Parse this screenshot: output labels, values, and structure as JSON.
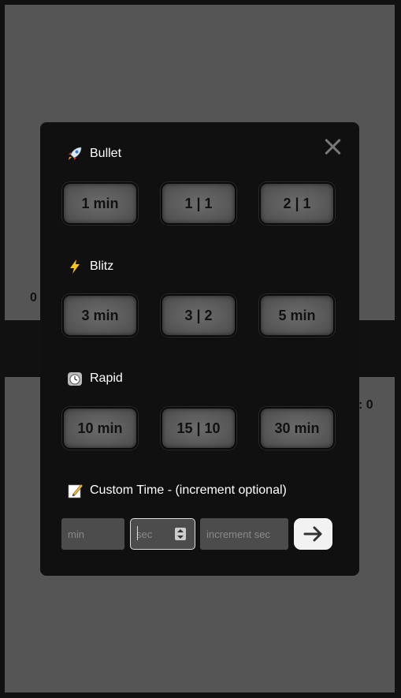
{
  "background": {
    "score_left": "0",
    "score_right": ": 0"
  },
  "modal": {
    "close_icon": "close-icon",
    "sections": [
      {
        "icon": "rocket-icon",
        "title": "Bullet",
        "options": [
          "1 min",
          "1 | 1",
          "2 | 1"
        ]
      },
      {
        "icon": "lightning-icon",
        "title": "Blitz",
        "options": [
          "3 min",
          "3 | 2",
          "5 min"
        ]
      },
      {
        "icon": "clock-icon",
        "title": "Rapid",
        "options": [
          "10 min",
          "15 | 10",
          "30 min"
        ]
      }
    ],
    "custom": {
      "icon": "memo-pencil-icon",
      "title": "Custom Time - (increment optional)",
      "min_placeholder": "min",
      "sec_placeholder": "sec",
      "increment_placeholder": "increment sec",
      "submit_icon": "arrow-right-icon"
    }
  },
  "colors": {
    "modal_bg": "#101010",
    "button_bg": "#5a5a5a",
    "board_bg": "#555555",
    "submit_bg": "#f2f2f2"
  }
}
